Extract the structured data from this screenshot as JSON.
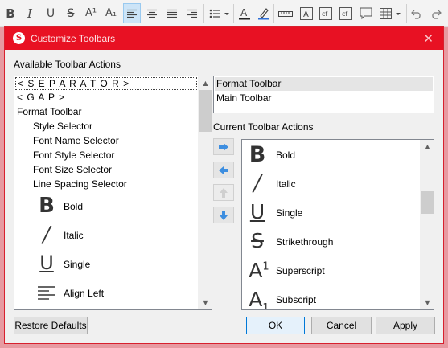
{
  "app_toolbar": {
    "bold": "B",
    "italic": "I",
    "underline": "U",
    "strikethrough": "S",
    "superscript": "A¹",
    "subscript": "A₁"
  },
  "dialog": {
    "title": "Customize Toolbars",
    "available_label": "Available Toolbar Actions",
    "available_items": [
      {
        "label": "< S E P A R A T O R >"
      },
      {
        "label": "< G A P >"
      },
      {
        "label": "Format Toolbar"
      },
      {
        "label": "Style Selector"
      },
      {
        "label": "Font Name Selector"
      },
      {
        "label": "Font Style Selector"
      },
      {
        "label": "Font Size Selector"
      },
      {
        "label": "Line Spacing Selector"
      },
      {
        "label": "Bold",
        "icon": "bold-icon"
      },
      {
        "label": "Italic",
        "icon": "italic-icon"
      },
      {
        "label": "Single",
        "icon": "underline-icon"
      },
      {
        "label": "Align Left",
        "icon": "align-left-icon"
      }
    ],
    "toolbars": [
      {
        "label": "Format Toolbar",
        "selected": true
      },
      {
        "label": "Main Toolbar",
        "selected": false
      }
    ],
    "current_label": "Current Toolbar Actions",
    "current_items": [
      {
        "label": "Bold",
        "icon": "bold-icon"
      },
      {
        "label": "Italic",
        "icon": "italic-icon"
      },
      {
        "label": "Single",
        "icon": "underline-icon"
      },
      {
        "label": "Strikethrough",
        "icon": "strikethrough-icon"
      },
      {
        "label": "Superscript",
        "icon": "superscript-icon"
      },
      {
        "label": "Subscript",
        "icon": "subscript-icon"
      }
    ],
    "buttons": {
      "restore": "Restore Defaults",
      "ok": "OK",
      "cancel": "Cancel",
      "apply": "Apply"
    }
  },
  "colors": {
    "titlebar": "#e81123",
    "accent": "#0078d7",
    "move_arrow": "#3d8ee0"
  }
}
